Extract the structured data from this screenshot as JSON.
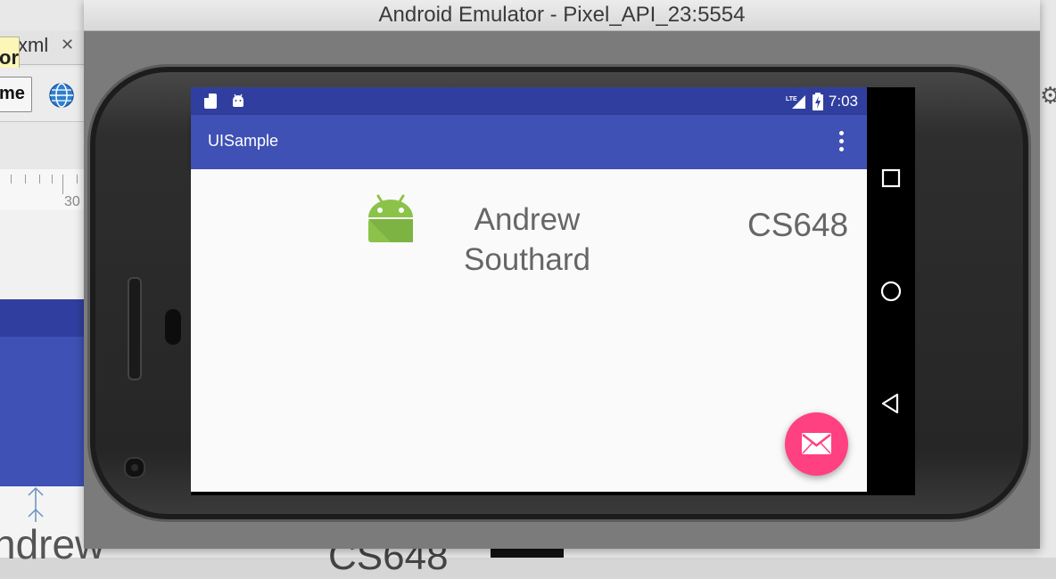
{
  "ide": {
    "tab_label": "xml",
    "tab_close": "✕",
    "tooltip_text": "or",
    "theme_button": "me",
    "ruler_label": "30",
    "preview_name_partial": "ndrew",
    "preview_course_partial": "CS648"
  },
  "window": {
    "title": "Android Emulator - Pixel_API_23:5554"
  },
  "device": {
    "status_bar": {
      "time": "7:03",
      "network": "LTE",
      "bg_color": "#303f9f"
    },
    "app_bar": {
      "title": "UISample",
      "bg_color": "#3f51b5",
      "menu_icon": "more-vert-icon"
    },
    "content": {
      "icon": "android-icon",
      "name_line1": "Andrew",
      "name_line2": "Southard",
      "course": "CS648"
    },
    "fab": {
      "icon": "email-icon",
      "color": "#ff4081"
    },
    "nav_bar": [
      "recents-icon",
      "home-icon",
      "back-icon"
    ]
  }
}
